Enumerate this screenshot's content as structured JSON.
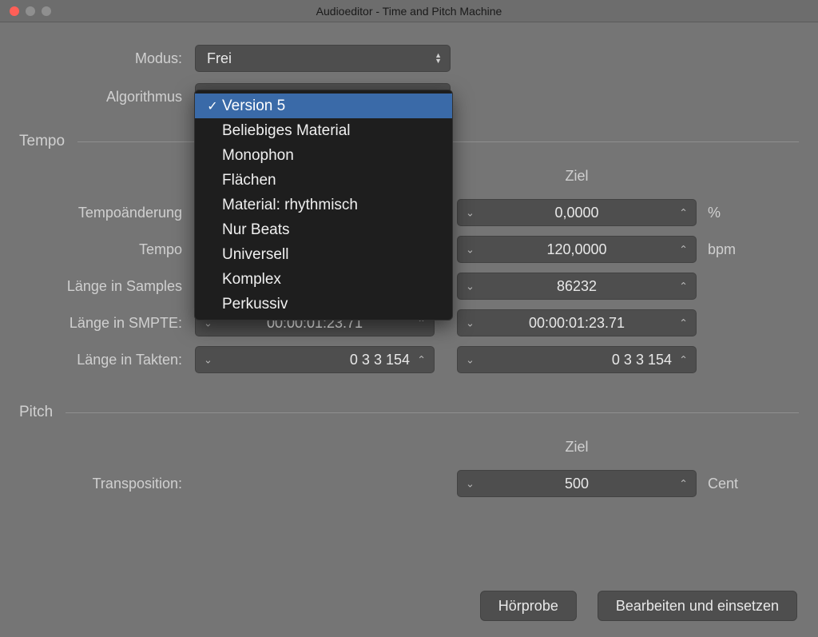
{
  "window": {
    "title": "Audioeditor - Time and Pitch Machine"
  },
  "modus": {
    "label": "Modus:",
    "value": "Frei"
  },
  "algorithmus": {
    "label": "Algorithmus",
    "options": [
      "Version 5",
      "Beliebiges Material",
      "Monophon",
      "Flächen",
      "Material: rhythmisch",
      "Nur Beats",
      "Universell",
      "Komplex",
      "Perkussiv"
    ],
    "selected_index": 0
  },
  "tempo": {
    "heading": "Tempo",
    "ziel_label": "Ziel",
    "rows": {
      "tempoaenderung": {
        "label": "Tempoänderung",
        "target": "0,0000",
        "unit": "%"
      },
      "tempo": {
        "label": "Tempo",
        "target": "120,0000",
        "unit": "bpm"
      },
      "samples": {
        "label": "Länge in Samples",
        "target": "86232",
        "unit": ""
      },
      "smpte": {
        "label": "Länge in SMPTE:",
        "original": "00:00:01:23.71",
        "target": "00:00:01:23.71",
        "unit": ""
      },
      "takten": {
        "label": "Länge in Takten:",
        "original": "0 3 3 154",
        "target": "0 3 3 154",
        "unit": ""
      }
    }
  },
  "pitch": {
    "heading": "Pitch",
    "ziel_label": "Ziel",
    "transposition": {
      "label": "Transposition:",
      "target": "500",
      "unit": "Cent"
    }
  },
  "buttons": {
    "preview": "Hörprobe",
    "apply": "Bearbeiten und einsetzen"
  }
}
